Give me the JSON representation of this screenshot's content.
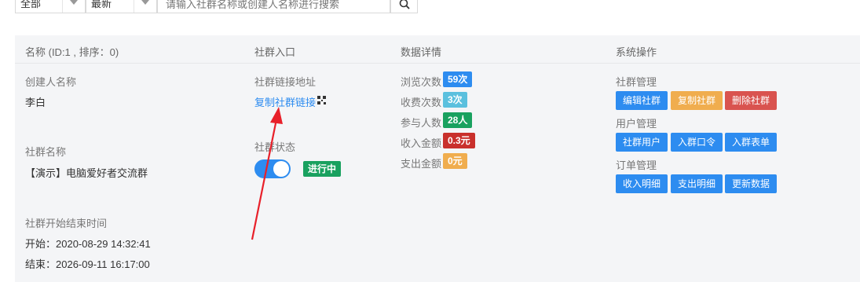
{
  "filters": {
    "category_select": "全部",
    "sort_select": "最新",
    "search_placeholder": "请输入社群名称或创建人名称进行搜索"
  },
  "table": {
    "headers": [
      "名称 (ID:1 , 排序：0)",
      "社群入口",
      "数据详情",
      "系统操作"
    ]
  },
  "group": {
    "creator_label": "创建人名称",
    "creator_value": "李白",
    "name_label": "社群名称",
    "name_value": "【演示】电脑爱好者交流群",
    "time_label": "社群开始结束时间",
    "start_text": "开始：2020-08-29 14:32:41",
    "end_text": "结束：2026-09-11 16:17:00"
  },
  "entry": {
    "link_label": "社群链接地址",
    "copy_link_text": "复制社群链接",
    "status_label": "社群状态",
    "status_badge": "进行中"
  },
  "stats": [
    {
      "label": "浏览次数",
      "value": "59次",
      "color": "#2d8cf0"
    },
    {
      "label": "收费次数",
      "value": "3次",
      "color": "#5bc0de"
    },
    {
      "label": "参与人数",
      "value": "28人",
      "color": "#19a15f"
    },
    {
      "label": "收入金额",
      "value": "0.3元",
      "color": "#c9302c"
    },
    {
      "label": "支出金额",
      "value": "0元",
      "color": "#f0ad4e"
    }
  ],
  "ops": {
    "group_mgmt_label": "社群管理",
    "edit_group": "编辑社群",
    "copy_group": "复制社群",
    "delete_group": "删除社群",
    "user_mgmt_label": "用户管理",
    "group_users": "社群用户",
    "join_password": "入群口令",
    "join_form": "入群表单",
    "order_mgmt_label": "订单管理",
    "income_detail": "收入明细",
    "expense_detail": "支出明细",
    "refresh_data": "更新数据"
  },
  "colors": {
    "primary": "#2d8cf0",
    "orange": "#f0ad4e",
    "danger": "#d9534f",
    "success": "#19a15f",
    "annotation_arrow": "#e8202a"
  }
}
